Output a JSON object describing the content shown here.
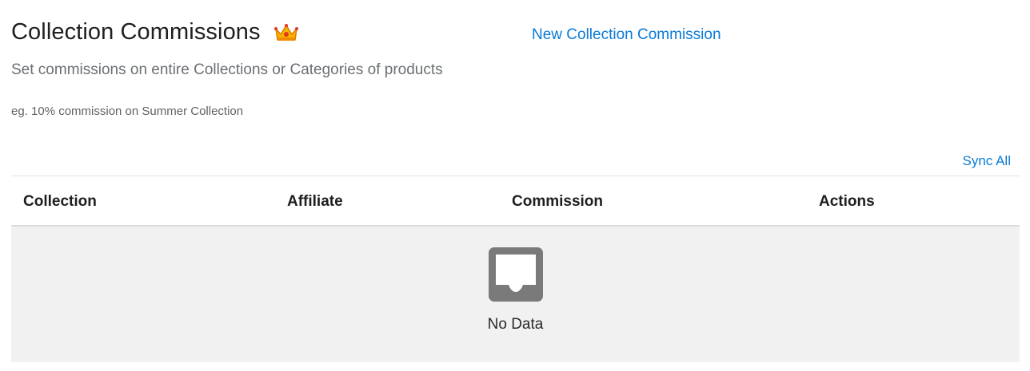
{
  "header": {
    "title": "Collection Commissions",
    "crown_icon": "crown-icon",
    "new_link": "New Collection Commission",
    "subtitle": "Set commissions on entire Collections or Categories of products",
    "example": "eg. 10% commission on Summer Collection"
  },
  "toolbar": {
    "sync_all": "Sync All"
  },
  "table": {
    "columns": [
      "Collection",
      "Affiliate",
      "Commission",
      "Actions"
    ],
    "rows": [],
    "empty_icon": "inbox-icon",
    "empty_text": "No Data"
  },
  "colors": {
    "link": "#0a7ad6",
    "empty_bg": "#f1f1f1",
    "empty_icon": "#7a7a7a"
  }
}
